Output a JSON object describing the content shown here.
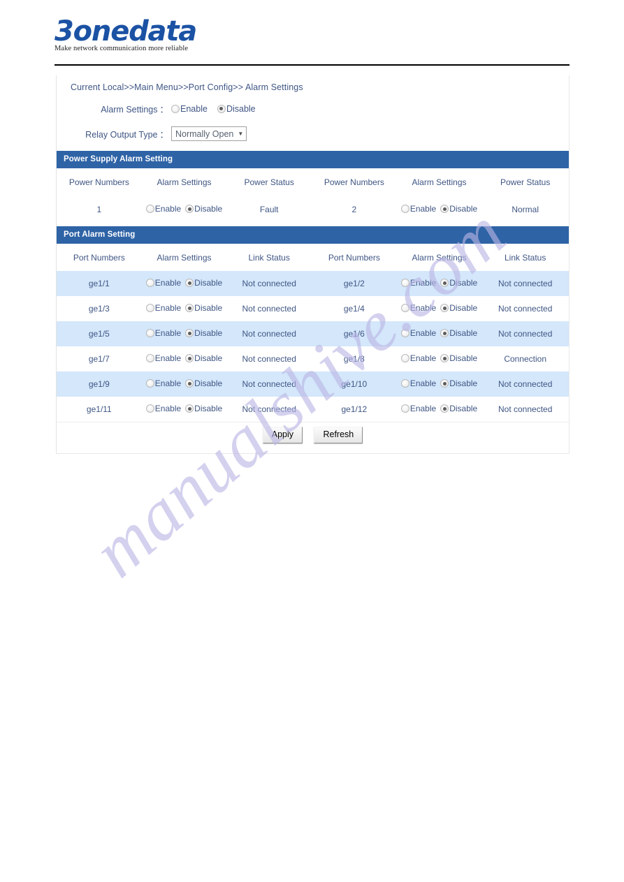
{
  "brand": {
    "name": "3onedata",
    "tagline": "Make network communication more reliable"
  },
  "breadcrumb": "Current Local>>Main Menu>>Port Config>> Alarm Settings",
  "form": {
    "alarm_settings_label": "Alarm Settings",
    "colon": "：",
    "alarm_enable_label": "Enable",
    "alarm_disable_label": "Disable",
    "alarm_selected": "Disable",
    "relay_label": "Relay Output Type",
    "relay_value": "Normally Open",
    "relay_caret": "▼"
  },
  "power_section": {
    "title": "Power Supply Alarm Setting",
    "headers": [
      "Power Numbers",
      "Alarm Settings",
      "Power Status",
      "Power Numbers",
      "Alarm Settings",
      "Power Status"
    ],
    "enable_label": "Enable",
    "disable_label": "Disable",
    "rows": [
      {
        "left_number": "1",
        "left_selected": "Disable",
        "left_status": "Fault",
        "right_number": "2",
        "right_selected": "Disable",
        "right_status": "Normal"
      }
    ]
  },
  "port_section": {
    "title": "Port Alarm Setting",
    "headers": [
      "Port Numbers",
      "Alarm Settings",
      "Link Status",
      "Port Numbers",
      "Alarm Settings",
      "Link Status"
    ],
    "enable_label": "Enable",
    "disable_label": "Disable",
    "rows": [
      {
        "left_number": "ge1/1",
        "left_selected": "Disable",
        "left_status": "Not connected",
        "right_number": "ge1/2",
        "right_selected": "Disable",
        "right_status": "Not connected"
      },
      {
        "left_number": "ge1/3",
        "left_selected": "Disable",
        "left_status": "Not connected",
        "right_number": "ge1/4",
        "right_selected": "Disable",
        "right_status": "Not connected"
      },
      {
        "left_number": "ge1/5",
        "left_selected": "Disable",
        "left_status": "Not connected",
        "right_number": "ge1/6",
        "right_selected": "Disable",
        "right_status": "Not connected"
      },
      {
        "left_number": "ge1/7",
        "left_selected": "Disable",
        "left_status": "Not connected",
        "right_number": "ge1/8",
        "right_selected": "Disable",
        "right_status": "Connection"
      },
      {
        "left_number": "ge1/9",
        "left_selected": "Disable",
        "left_status": "Not connected",
        "right_number": "ge1/10",
        "right_selected": "Disable",
        "right_status": "Not connected"
      },
      {
        "left_number": "ge1/11",
        "left_selected": "Disable",
        "left_status": "Not connected",
        "right_number": "ge1/12",
        "right_selected": "Disable",
        "right_status": "Not connected"
      }
    ]
  },
  "buttons": {
    "apply": "Apply",
    "refresh": "Refresh"
  },
  "watermark": {
    "text": "manualshive.com",
    "color": "#b9b6e4"
  },
  "colors": {
    "section_bar": "#2e63a6",
    "row_stripe": "#d4e7fb",
    "text": "#3f5684",
    "logo": "#1b52a4"
  }
}
